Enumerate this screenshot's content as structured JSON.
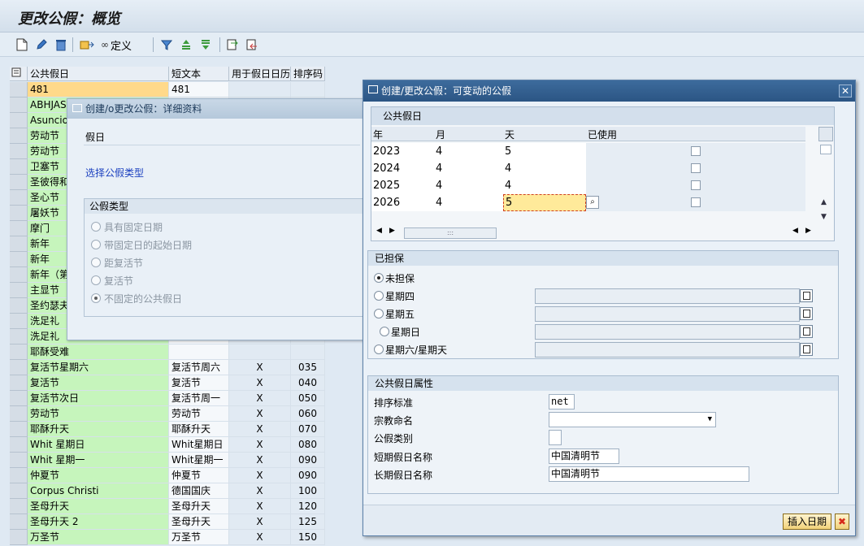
{
  "title": "更改公假：概览",
  "toolbar": {
    "define_label": "定义"
  },
  "table": {
    "headers": [
      "公共假日",
      "短文本",
      "用于假日日历",
      "排序码"
    ],
    "rows": [
      {
        "name": "481",
        "short": "481",
        "used": "",
        "sort": ""
      },
      {
        "name": "ABHJASG",
        "short": "",
        "used": "",
        "sort": ""
      },
      {
        "name": "Asuncion",
        "short": "",
        "used": "",
        "sort": ""
      },
      {
        "name": "劳动节",
        "short": "",
        "used": "",
        "sort": ""
      },
      {
        "name": "劳动节",
        "short": "",
        "used": "",
        "sort": ""
      },
      {
        "name": "卫塞节",
        "short": "",
        "used": "",
        "sort": ""
      },
      {
        "name": "圣彼得和",
        "short": "",
        "used": "",
        "sort": ""
      },
      {
        "name": "圣心节",
        "short": "",
        "used": "",
        "sort": ""
      },
      {
        "name": "屠妖节",
        "short": "",
        "used": "",
        "sort": ""
      },
      {
        "name": "摩门",
        "short": "",
        "used": "",
        "sort": ""
      },
      {
        "name": "新年",
        "short": "",
        "used": "",
        "sort": ""
      },
      {
        "name": "新年",
        "short": "",
        "used": "",
        "sort": ""
      },
      {
        "name": "新年（第",
        "short": "",
        "used": "",
        "sort": ""
      },
      {
        "name": "主显节",
        "short": "",
        "used": "",
        "sort": ""
      },
      {
        "name": "圣约瑟夫",
        "short": "",
        "used": "",
        "sort": ""
      },
      {
        "name": "洗足礼",
        "short": "",
        "used": "",
        "sort": ""
      },
      {
        "name": "洗足礼",
        "short": "",
        "used": "",
        "sort": ""
      },
      {
        "name": "耶酥受难",
        "short": "",
        "used": "",
        "sort": ""
      },
      {
        "name": "复活节星期六",
        "short": "复活节周六",
        "used": "X",
        "sort": "035"
      },
      {
        "name": "复活节",
        "short": "复活节",
        "used": "X",
        "sort": "040"
      },
      {
        "name": "复活节次日",
        "short": "复活节周一",
        "used": "X",
        "sort": "050"
      },
      {
        "name": "劳动节",
        "short": "劳动节",
        "used": "X",
        "sort": "060"
      },
      {
        "name": "耶酥升天",
        "short": "耶酥升天",
        "used": "X",
        "sort": "070"
      },
      {
        "name": "Whit 星期日",
        "short": "Whit星期日",
        "used": "X",
        "sort": "080"
      },
      {
        "name": "Whit 星期一",
        "short": "Whit星期一",
        "used": "X",
        "sort": "090"
      },
      {
        "name": "仲夏节",
        "short": "仲夏节",
        "used": "X",
        "sort": "090"
      },
      {
        "name": "Corpus Christi",
        "short": "德国国庆",
        "used": "X",
        "sort": "100"
      },
      {
        "name": "圣母升天",
        "short": "圣母升天",
        "used": "X",
        "sort": "120"
      },
      {
        "name": "圣母升天 2",
        "short": "圣母升天",
        "used": "X",
        "sort": "125"
      },
      {
        "name": "万圣节",
        "short": "万圣节",
        "used": "X",
        "sort": "150"
      }
    ]
  },
  "detail_dialog": {
    "title": "创建/o更改公假：详细资料",
    "section": "假日",
    "link": "选择公假类型",
    "group_title": "公假类型",
    "options": [
      {
        "label": "具有固定日期",
        "checked": false
      },
      {
        "label": "带固定日的起始日期",
        "checked": false
      },
      {
        "label": "距复活节",
        "checked": false
      },
      {
        "label": "复活节",
        "checked": false
      },
      {
        "label": "不固定的公共假日",
        "checked": true
      }
    ]
  },
  "main_dialog": {
    "title": "创建/更改公假：可变动的公假",
    "holiday_table": {
      "caption": "公共假日",
      "headers": [
        "年",
        "月",
        "天",
        "已使用"
      ],
      "rows": [
        {
          "year": "2023",
          "month": "4",
          "day": "5",
          "used": false
        },
        {
          "year": "2024",
          "month": "4",
          "day": "4",
          "used": false
        },
        {
          "year": "2025",
          "month": "4",
          "day": "4",
          "used": false
        },
        {
          "year": "2026",
          "month": "4",
          "day": "5",
          "used": false
        }
      ],
      "scroll_grip": ":::"
    },
    "guarantee": {
      "title": "已担保",
      "options": [
        {
          "label": "未担保",
          "checked": true
        },
        {
          "label": "星期四",
          "checked": false
        },
        {
          "label": "星期五",
          "checked": false
        },
        {
          "label": "星期日",
          "checked": false
        },
        {
          "label": "星期六/星期天",
          "checked": false
        }
      ]
    },
    "attributes": {
      "title": "公共假日属性",
      "sort_label": "排序标准",
      "sort_value": "net",
      "religion_label": "宗教命名",
      "religion_value": "",
      "category_label": "公假类别",
      "category_value": "",
      "short_label": "短期假日名称",
      "short_value": "中国清明节",
      "long_label": "长期假日名称",
      "long_value": "中国清明节"
    },
    "insert_button": "插入日期"
  },
  "colors": {
    "green": "#c6f5bc",
    "yellow": "#ffd98a",
    "header_blue": "#2b5584"
  }
}
